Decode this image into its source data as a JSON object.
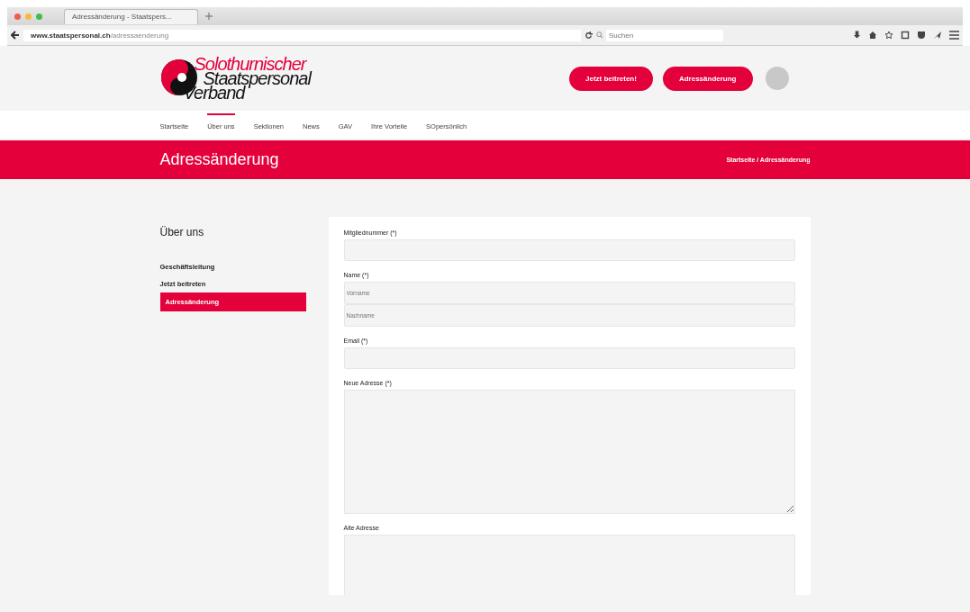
{
  "browser": {
    "tab_title": "Adressänderung - Staatspers...",
    "url_domain": "www.staatspersonal.ch",
    "url_path": "/adressaenderung",
    "search_placeholder": "Suchen"
  },
  "header": {
    "logo_lines": [
      "Solothurnischer",
      "Staatspersonal",
      "Verband"
    ],
    "buttons": [
      "Jetzt beitreten!",
      "Adressänderung"
    ]
  },
  "nav": [
    {
      "label": "Startseite",
      "selected": false
    },
    {
      "label": "Über uns",
      "selected": true
    },
    {
      "label": "Sektionen",
      "selected": false
    },
    {
      "label": "News",
      "selected": false
    },
    {
      "label": "GAV",
      "selected": false
    },
    {
      "label": "Ihre Vorteile",
      "selected": false
    },
    {
      "label": "SOpersönlich",
      "selected": false
    }
  ],
  "banner": {
    "title": "Adressänderung",
    "breadcrumb": "Startseite / Adressänderung"
  },
  "sidebar": {
    "title": "Über uns",
    "items": [
      {
        "label": "Geschäftsleitung",
        "selected": false
      },
      {
        "label": "Jetzt beitreten",
        "selected": false
      },
      {
        "label": "Adressänderung",
        "selected": true
      }
    ]
  },
  "form": [
    {
      "kind": "input",
      "label": "Mitgliednummer (*)"
    },
    {
      "kind": "name",
      "label": "Name (*)",
      "placeholders": [
        "Vorname",
        "Nachname"
      ]
    },
    {
      "kind": "input",
      "label": "Email (*)"
    },
    {
      "kind": "textarea",
      "label": "Neue Adresse (*)"
    },
    {
      "kind": "textarea",
      "label": "Alte Adresse"
    }
  ]
}
